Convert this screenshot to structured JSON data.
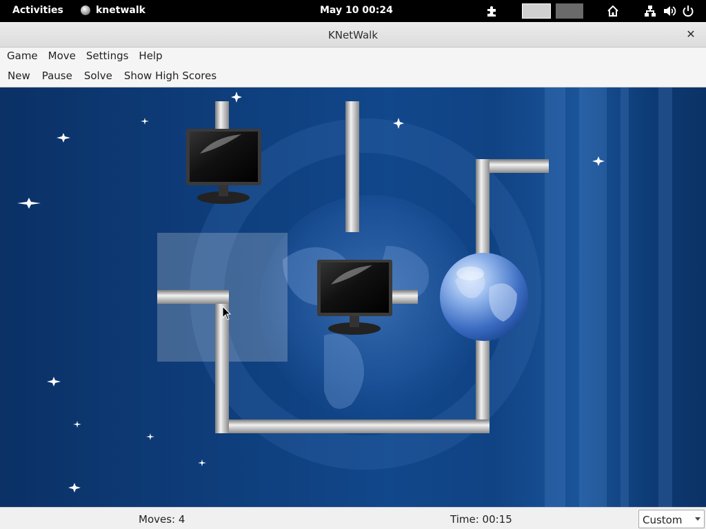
{
  "topbar": {
    "activities": "Activities",
    "app_name": "knetwalk",
    "clock": "May 10  00:24",
    "icons": [
      "extensions-icon",
      "workspace-1",
      "workspace-2",
      "home-icon",
      "network-icon",
      "volume-icon",
      "power-icon"
    ]
  },
  "window": {
    "title": "KNetWalk",
    "close_glyph": "✕"
  },
  "menubar": {
    "items": [
      "Game",
      "Move",
      "Settings",
      "Help"
    ]
  },
  "toolbar": {
    "new": "New",
    "pause": "Pause",
    "solve": "Solve",
    "high_scores": "Show High Scores"
  },
  "board": {
    "grid_cols": 4,
    "grid_rows": 3,
    "server": {
      "col": 3,
      "row": 1
    },
    "terminals": [
      {
        "col": 1,
        "row": 0
      },
      {
        "col": 2,
        "row": 1
      }
    ],
    "selected_cell": {
      "col": 1,
      "row": 1
    },
    "colors": {
      "background": "#0e3d7a",
      "cable": "#c8c8c8",
      "highlight": "#ffffff"
    }
  },
  "statusbar": {
    "moves": "Moves: 4",
    "time": "Time: 00:15",
    "difficulty": "Custom"
  }
}
